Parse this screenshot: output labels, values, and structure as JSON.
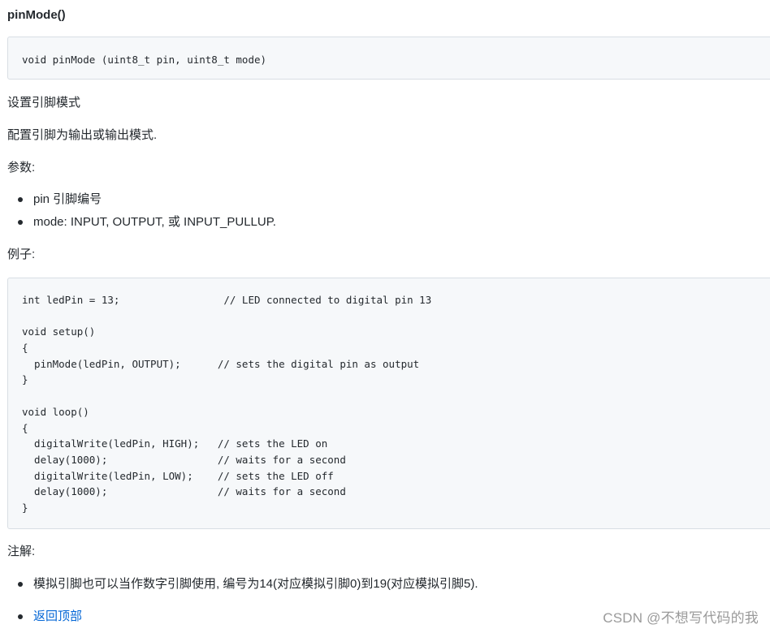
{
  "heading": "pinMode()",
  "signature": "void pinMode (uint8_t pin, uint8_t mode)",
  "summary": "设置引脚模式",
  "description": "配置引脚为输出或输出模式.",
  "params_label": "参数:",
  "params": [
    "pin 引脚编号",
    "mode: INPUT, OUTPUT, 或 INPUT_PULLUP."
  ],
  "example_label": "例子:",
  "example_code": [
    "int ledPin = 13;                 // LED connected to digital pin 13",
    "",
    "void setup()",
    "{",
    "  pinMode(ledPin, OUTPUT);      // sets the digital pin as output",
    "}",
    "",
    "void loop()",
    "{",
    "  digitalWrite(ledPin, HIGH);   // sets the LED on",
    "  delay(1000);                  // waits for a second",
    "  digitalWrite(ledPin, LOW);    // sets the LED off",
    "  delay(1000);                  // waits for a second",
    "}"
  ],
  "notes_label": "注解:",
  "notes": [
    "模拟引脚也可以当作数字引脚使用, 编号为14(对应模拟引脚0)到19(对应模拟引脚5)."
  ],
  "back_to_top": "返回顶部",
  "watermark": "CSDN @不想写代码的我",
  "colors": {
    "text": "#24292e",
    "link": "#0366d6",
    "code_bg": "#f6f8fa",
    "code_border": "#d8dee4",
    "watermark": "#9a9a9a"
  }
}
